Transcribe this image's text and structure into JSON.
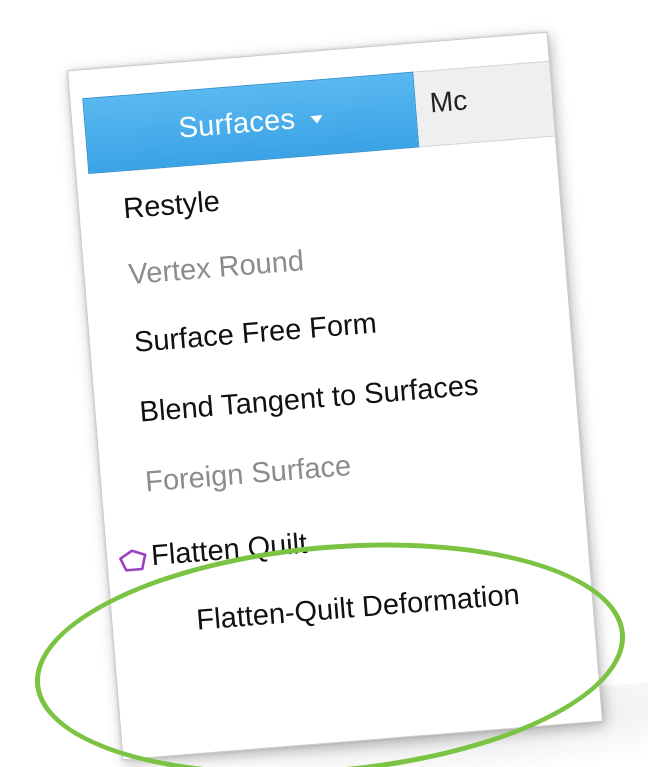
{
  "ribbon": {
    "active_tab": {
      "label": "Surfaces",
      "icon": "caret-down-icon"
    },
    "next_tab": {
      "label": "Mc"
    }
  },
  "menu": {
    "items": [
      {
        "label": "Restyle",
        "enabled": true
      },
      {
        "label": "Vertex Round",
        "enabled": false
      },
      {
        "label": "Surface Free Form",
        "enabled": true
      },
      {
        "label": "Blend Tangent to Surfaces",
        "enabled": true
      },
      {
        "label": "Foreign Surface",
        "enabled": false
      },
      {
        "label": "Flatten Quilt",
        "enabled": true,
        "icon": "flatten-quilt-icon"
      },
      {
        "label": "Flatten-Quilt Deformation",
        "enabled": true
      }
    ]
  },
  "annotation": {
    "type": "ellipse",
    "color": "#7bc342"
  },
  "colors": {
    "tab_active": "#3aa3e6",
    "text_enabled": "#111111",
    "text_disabled": "#8c8c8c",
    "icon_stroke": "#9b3fbf"
  }
}
